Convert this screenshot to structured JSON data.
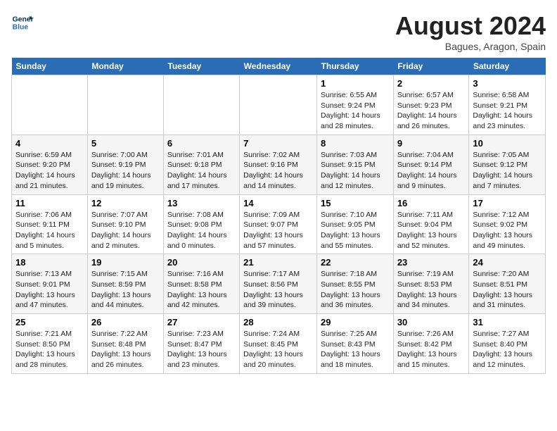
{
  "header": {
    "logo_general": "General",
    "logo_blue": "Blue",
    "month_title": "August 2024",
    "subtitle": "Bagues, Aragon, Spain"
  },
  "weekdays": [
    "Sunday",
    "Monday",
    "Tuesday",
    "Wednesday",
    "Thursday",
    "Friday",
    "Saturday"
  ],
  "weeks": [
    [
      {
        "day": "",
        "info": ""
      },
      {
        "day": "",
        "info": ""
      },
      {
        "day": "",
        "info": ""
      },
      {
        "day": "",
        "info": ""
      },
      {
        "day": "1",
        "info": "Sunrise: 6:55 AM\nSunset: 9:24 PM\nDaylight: 14 hours\nand 28 minutes."
      },
      {
        "day": "2",
        "info": "Sunrise: 6:57 AM\nSunset: 9:23 PM\nDaylight: 14 hours\nand 26 minutes."
      },
      {
        "day": "3",
        "info": "Sunrise: 6:58 AM\nSunset: 9:21 PM\nDaylight: 14 hours\nand 23 minutes."
      }
    ],
    [
      {
        "day": "4",
        "info": "Sunrise: 6:59 AM\nSunset: 9:20 PM\nDaylight: 14 hours\nand 21 minutes."
      },
      {
        "day": "5",
        "info": "Sunrise: 7:00 AM\nSunset: 9:19 PM\nDaylight: 14 hours\nand 19 minutes."
      },
      {
        "day": "6",
        "info": "Sunrise: 7:01 AM\nSunset: 9:18 PM\nDaylight: 14 hours\nand 17 minutes."
      },
      {
        "day": "7",
        "info": "Sunrise: 7:02 AM\nSunset: 9:16 PM\nDaylight: 14 hours\nand 14 minutes."
      },
      {
        "day": "8",
        "info": "Sunrise: 7:03 AM\nSunset: 9:15 PM\nDaylight: 14 hours\nand 12 minutes."
      },
      {
        "day": "9",
        "info": "Sunrise: 7:04 AM\nSunset: 9:14 PM\nDaylight: 14 hours\nand 9 minutes."
      },
      {
        "day": "10",
        "info": "Sunrise: 7:05 AM\nSunset: 9:12 PM\nDaylight: 14 hours\nand 7 minutes."
      }
    ],
    [
      {
        "day": "11",
        "info": "Sunrise: 7:06 AM\nSunset: 9:11 PM\nDaylight: 14 hours\nand 5 minutes."
      },
      {
        "day": "12",
        "info": "Sunrise: 7:07 AM\nSunset: 9:10 PM\nDaylight: 14 hours\nand 2 minutes."
      },
      {
        "day": "13",
        "info": "Sunrise: 7:08 AM\nSunset: 9:08 PM\nDaylight: 14 hours\nand 0 minutes."
      },
      {
        "day": "14",
        "info": "Sunrise: 7:09 AM\nSunset: 9:07 PM\nDaylight: 13 hours\nand 57 minutes."
      },
      {
        "day": "15",
        "info": "Sunrise: 7:10 AM\nSunset: 9:05 PM\nDaylight: 13 hours\nand 55 minutes."
      },
      {
        "day": "16",
        "info": "Sunrise: 7:11 AM\nSunset: 9:04 PM\nDaylight: 13 hours\nand 52 minutes."
      },
      {
        "day": "17",
        "info": "Sunrise: 7:12 AM\nSunset: 9:02 PM\nDaylight: 13 hours\nand 49 minutes."
      }
    ],
    [
      {
        "day": "18",
        "info": "Sunrise: 7:13 AM\nSunset: 9:01 PM\nDaylight: 13 hours\nand 47 minutes."
      },
      {
        "day": "19",
        "info": "Sunrise: 7:15 AM\nSunset: 8:59 PM\nDaylight: 13 hours\nand 44 minutes."
      },
      {
        "day": "20",
        "info": "Sunrise: 7:16 AM\nSunset: 8:58 PM\nDaylight: 13 hours\nand 42 minutes."
      },
      {
        "day": "21",
        "info": "Sunrise: 7:17 AM\nSunset: 8:56 PM\nDaylight: 13 hours\nand 39 minutes."
      },
      {
        "day": "22",
        "info": "Sunrise: 7:18 AM\nSunset: 8:55 PM\nDaylight: 13 hours\nand 36 minutes."
      },
      {
        "day": "23",
        "info": "Sunrise: 7:19 AM\nSunset: 8:53 PM\nDaylight: 13 hours\nand 34 minutes."
      },
      {
        "day": "24",
        "info": "Sunrise: 7:20 AM\nSunset: 8:51 PM\nDaylight: 13 hours\nand 31 minutes."
      }
    ],
    [
      {
        "day": "25",
        "info": "Sunrise: 7:21 AM\nSunset: 8:50 PM\nDaylight: 13 hours\nand 28 minutes."
      },
      {
        "day": "26",
        "info": "Sunrise: 7:22 AM\nSunset: 8:48 PM\nDaylight: 13 hours\nand 26 minutes."
      },
      {
        "day": "27",
        "info": "Sunrise: 7:23 AM\nSunset: 8:47 PM\nDaylight: 13 hours\nand 23 minutes."
      },
      {
        "day": "28",
        "info": "Sunrise: 7:24 AM\nSunset: 8:45 PM\nDaylight: 13 hours\nand 20 minutes."
      },
      {
        "day": "29",
        "info": "Sunrise: 7:25 AM\nSunset: 8:43 PM\nDaylight: 13 hours\nand 18 minutes."
      },
      {
        "day": "30",
        "info": "Sunrise: 7:26 AM\nSunset: 8:42 PM\nDaylight: 13 hours\nand 15 minutes."
      },
      {
        "day": "31",
        "info": "Sunrise: 7:27 AM\nSunset: 8:40 PM\nDaylight: 13 hours\nand 12 minutes."
      }
    ]
  ]
}
